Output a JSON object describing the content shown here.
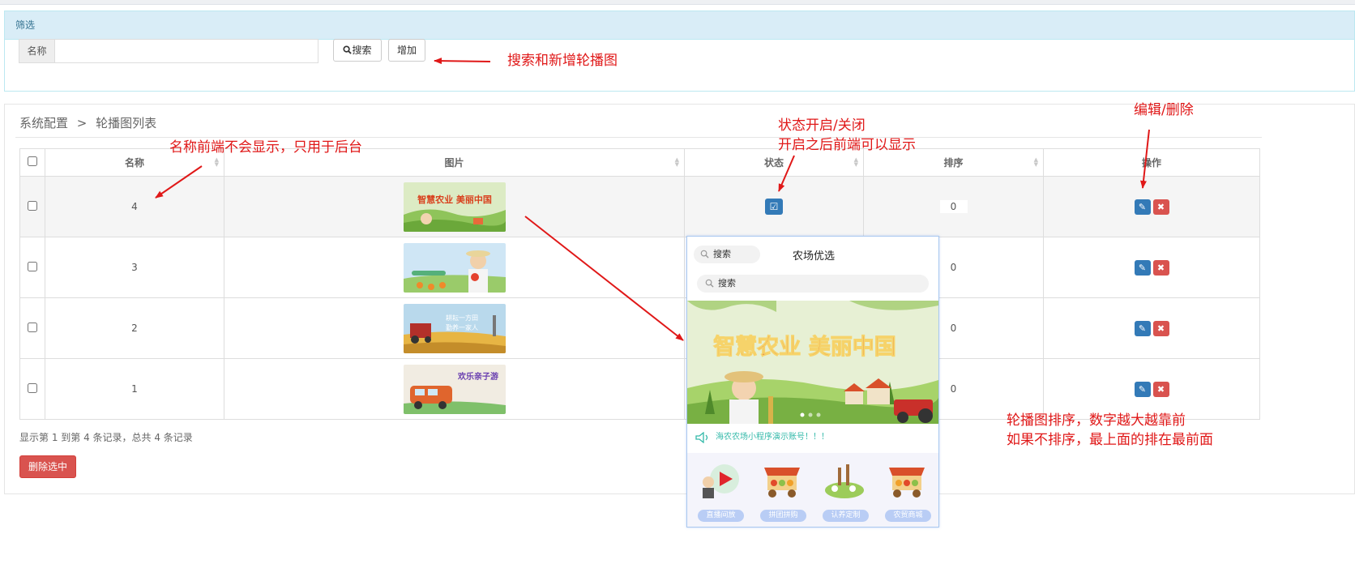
{
  "filter": {
    "title": "筛选",
    "name_label": "名称",
    "name_value": "",
    "search_label": "搜索",
    "add_label": "增加"
  },
  "breadcrumb": {
    "parent": "系统配置",
    "separator": ">",
    "current": "轮播图列表"
  },
  "table": {
    "columns": [
      "名称",
      "图片",
      "状态",
      "排序",
      "操作"
    ],
    "rows": [
      {
        "name": "4",
        "sort": "0",
        "image": "banner-smart-agriculture"
      },
      {
        "name": "3",
        "sort": "0",
        "image": "banner-farmer-harvest"
      },
      {
        "name": "2",
        "sort": "0",
        "image": "banner-harvester"
      },
      {
        "name": "1",
        "sort": "0",
        "image": "banner-family-trip"
      }
    ]
  },
  "pagination": {
    "summary": "显示第 1 到第 4 条记录，总共 4 条记录"
  },
  "bulk": {
    "delete_label": "删除选中"
  },
  "annotations": {
    "search_add": "搜索和新增轮播图",
    "name_note": "名称前端不会显示，只用于后台",
    "status_note_1": "状态开启/关闭",
    "status_note_2": "开启之后前端可以显示",
    "ops_note": "编辑/删除",
    "sort_note_1": "轮播图排序，数字越大越靠前",
    "sort_note_2": "如果不排序，最上面的排在最前面"
  },
  "phone": {
    "pill_search": "搜索",
    "title": "农场优选",
    "search_placeholder": "搜索",
    "banner_text": "智慧农业 美丽中国",
    "notice": "海农农场小程序演示账号！！！",
    "nav": [
      "直播间放",
      "拼团拼购",
      "认养定制",
      "农贸商城"
    ]
  },
  "thumb_texts": {
    "banner4": "智慧农业 美丽中国",
    "banner2_line1": "耕耘一方田",
    "banner2_line2": "勤养一家人",
    "banner1": "欢乐亲子游"
  },
  "colors": {
    "primary": "#337ab7",
    "danger": "#d9534f",
    "panel_head": "#d9edf7",
    "annotation": "#e01818"
  },
  "icons": [
    "search-icon",
    "edit-icon",
    "delete-icon",
    "checkbox-icon",
    "sort-icon",
    "speaker-icon"
  ]
}
